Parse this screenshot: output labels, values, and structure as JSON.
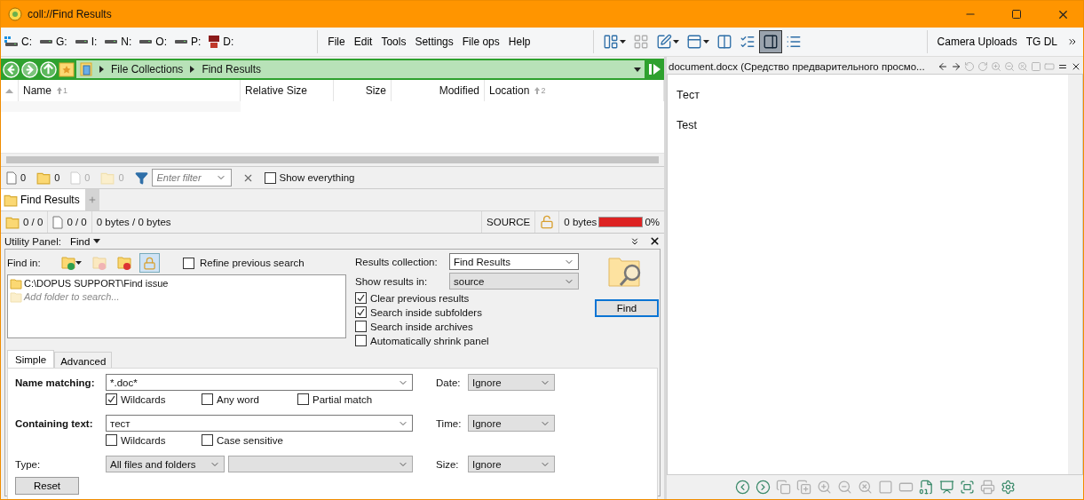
{
  "window": {
    "title": "coll://Find Results"
  },
  "drives": [
    {
      "label": "C:",
      "kind": "system"
    },
    {
      "label": "G:",
      "kind": "drive"
    },
    {
      "label": "I:",
      "kind": "drive"
    },
    {
      "label": "N:",
      "kind": "drive"
    },
    {
      "label": "O:",
      "kind": "drive"
    },
    {
      "label": "P:",
      "kind": "drive"
    },
    {
      "label": "D:",
      "kind": "sd"
    }
  ],
  "menu": [
    "File",
    "Edit",
    "Tools",
    "Settings",
    "File ops",
    "Help"
  ],
  "toolbar": [
    {
      "kind": "layout",
      "dropdown": true,
      "selected": false,
      "disabled": false
    },
    {
      "kind": "tiles",
      "dropdown": false,
      "selected": false,
      "disabled": true
    },
    {
      "kind": "edit",
      "dropdown": true,
      "selected": false,
      "disabled": false
    },
    {
      "kind": "panes",
      "dropdown": true,
      "selected": false,
      "disabled": false
    },
    {
      "kind": "columns",
      "dropdown": false,
      "selected": false,
      "disabled": false
    },
    {
      "kind": "checklist",
      "dropdown": false,
      "selected": false,
      "disabled": false
    },
    {
      "kind": "preview",
      "dropdown": false,
      "selected": true,
      "disabled": false
    },
    {
      "kind": "list",
      "dropdown": false,
      "selected": false,
      "disabled": false
    }
  ],
  "links": [
    "Camera Uploads",
    "TG DL"
  ],
  "path": {
    "crumbs": [
      "File Collections",
      "Find Results"
    ]
  },
  "columns": [
    {
      "label": "Name",
      "sort": "1"
    },
    {
      "label": "Relative Size"
    },
    {
      "label": "Size"
    },
    {
      "label": "Modified"
    },
    {
      "label": "Location",
      "sort": "2"
    }
  ],
  "filter_bar": {
    "counts": [
      {
        "kind": "file",
        "value": "0",
        "disabled": false
      },
      {
        "kind": "folder",
        "value": "0",
        "disabled": false
      },
      {
        "kind": "file",
        "value": "0",
        "disabled": true
      },
      {
        "kind": "folder",
        "value": "0",
        "disabled": true
      }
    ],
    "placeholder": "Enter filter",
    "show_everything": {
      "label": "Show everything",
      "checked": false
    }
  },
  "tabs": [
    {
      "label": "Find Results",
      "selected": true
    }
  ],
  "status": {
    "folders": "0 / 0",
    "files": "0 / 0",
    "bytes": "0 bytes / 0 bytes",
    "source": "SOURCE",
    "free": "0 bytes",
    "level": 1,
    "percent": "0%"
  },
  "utility": {
    "label": "Utility Panel:",
    "mode": "Find"
  },
  "find": {
    "find_in": "Find in:",
    "refine": {
      "label": "Refine previous search",
      "checked": false
    },
    "folders": [
      {
        "kind": "folder",
        "text": "C:\\DOPUS SUPPORT\\Find issue"
      },
      {
        "kind": "placeholder",
        "text": "Add folder to search..."
      }
    ],
    "results_collection": {
      "label": "Results collection:",
      "value": "Find Results"
    },
    "show_results_in": {
      "label": "Show results in:",
      "value": "source"
    },
    "options": [
      {
        "label": "Clear previous results",
        "checked": true
      },
      {
        "label": "Search inside subfolders",
        "checked": true
      },
      {
        "label": "Search inside archives",
        "checked": false
      },
      {
        "label": "Automatically shrink panel",
        "checked": false
      }
    ],
    "button": "Find",
    "tabs": [
      {
        "label": "Simple",
        "selected": true
      },
      {
        "label": "Advanced",
        "selected": false
      }
    ],
    "name_matching": {
      "label": "Name matching:",
      "value": "*.doc*",
      "options": [
        {
          "label": "Wildcards",
          "checked": true
        },
        {
          "label": "Any word",
          "checked": false
        },
        {
          "label": "Partial match",
          "checked": false
        }
      ]
    },
    "containing_text": {
      "label": "Containing text:",
      "value": "тест",
      "options": [
        {
          "label": "Wildcards",
          "checked": false
        },
        {
          "label": "Case sensitive",
          "checked": false
        }
      ]
    },
    "type": {
      "label": "Type:",
      "value": "All files and folders"
    },
    "filters": [
      {
        "label": "Date:",
        "value": "Ignore"
      },
      {
        "label": "Time:",
        "value": "Ignore"
      },
      {
        "label": "Size:",
        "value": "Ignore"
      }
    ],
    "reset": "Reset"
  },
  "preview": {
    "title": "document.docx (Средство предварительного просмо...",
    "tools": [
      {
        "kind": "back",
        "disabled": false
      },
      {
        "kind": "forward",
        "disabled": false
      },
      {
        "kind": "rotl",
        "disabled": true
      },
      {
        "kind": "rotr",
        "disabled": true
      },
      {
        "kind": "zoomin",
        "disabled": true
      },
      {
        "kind": "zoomout",
        "disabled": true
      },
      {
        "kind": "zoomreset",
        "disabled": true
      },
      {
        "kind": "fit",
        "disabled": true
      },
      {
        "kind": "fill",
        "disabled": true
      },
      {
        "kind": "menu",
        "disabled": false
      },
      {
        "kind": "close",
        "disabled": false
      }
    ],
    "lines": [
      "Тест",
      "Test"
    ],
    "controls": [
      {
        "kind": "prev",
        "disabled": false
      },
      {
        "kind": "next",
        "disabled": false
      },
      {
        "kind": "copyl",
        "disabled": true
      },
      {
        "kind": "copyr",
        "disabled": true
      },
      {
        "kind": "zoomin",
        "disabled": true
      },
      {
        "kind": "zoomout",
        "disabled": true
      },
      {
        "kind": "zoomreset",
        "disabled": true
      },
      {
        "kind": "fit",
        "disabled": true
      },
      {
        "kind": "fill",
        "disabled": true
      },
      {
        "kind": "hex",
        "disabled": false
      },
      {
        "kind": "slideshow",
        "disabled": false
      },
      {
        "kind": "fullscreen",
        "disabled": false
      },
      {
        "kind": "print",
        "disabled": true
      },
      {
        "kind": "settings",
        "disabled": false
      }
    ]
  }
}
